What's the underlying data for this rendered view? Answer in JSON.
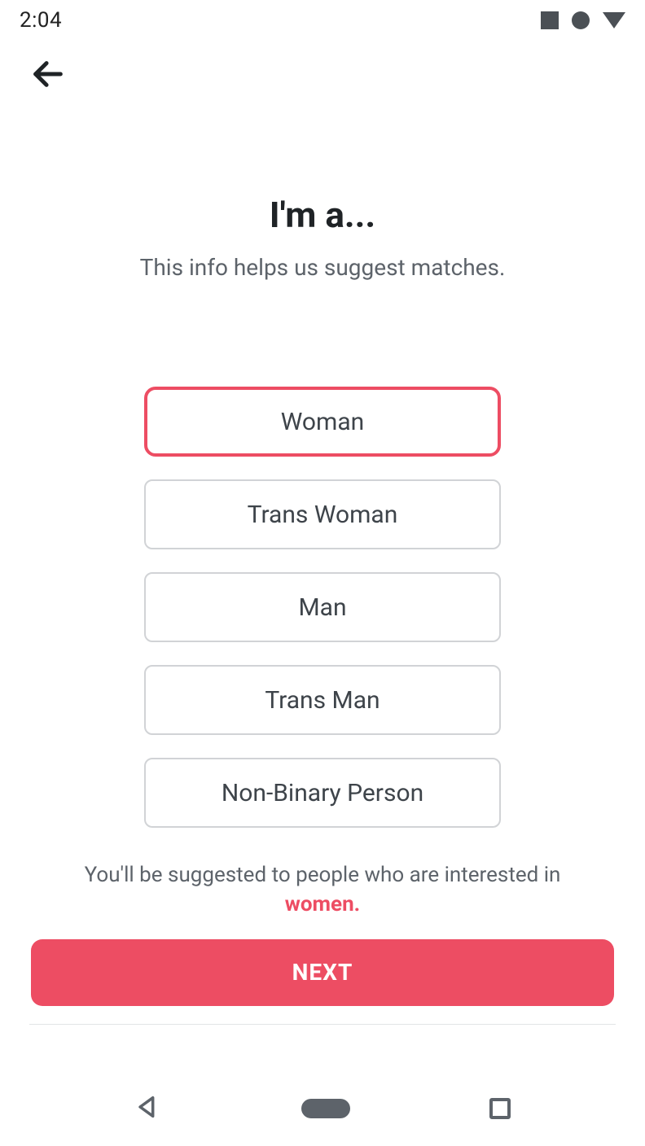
{
  "statusbar": {
    "time": "2:04"
  },
  "header": {
    "title": "I'm a...",
    "subtitle": "This info helps us suggest matches."
  },
  "options": [
    {
      "label": "Woman",
      "selected": true
    },
    {
      "label": "Trans Woman",
      "selected": false
    },
    {
      "label": "Man",
      "selected": false
    },
    {
      "label": "Trans Man",
      "selected": false
    },
    {
      "label": "Non-Binary Person",
      "selected": false
    }
  ],
  "hint": {
    "prefix": "You'll be suggested to people who are interested in ",
    "accent": "women."
  },
  "buttons": {
    "next": "NEXT"
  },
  "colors": {
    "accent": "#ed4d63",
    "text_primary": "#1f2326",
    "text_secondary": "#5d636a",
    "border": "#d1d3d6"
  }
}
